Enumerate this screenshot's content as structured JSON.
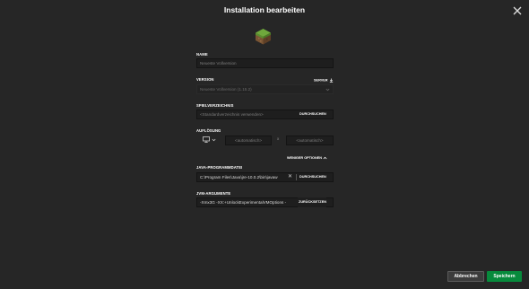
{
  "dialog": {
    "title": "Installation bearbeiten",
    "close_icon": "close-icon",
    "block_icon": "grass-block-icon"
  },
  "name": {
    "label": "NAME",
    "placeholder": "Neueste Vollversion"
  },
  "version": {
    "label": "VERSION",
    "server_link": "SERVER",
    "server_icon": "download-icon",
    "value": "Neueste Vollversion (1.15.2)",
    "chevron_icon": "chevron-down-icon"
  },
  "game_dir": {
    "label": "SPIELVERZEICHNIS",
    "placeholder": "<Standardverzeichnis verwenden>",
    "browse_label": "DURCHSUCHEN"
  },
  "resolution": {
    "label": "AUFLÖSUNG",
    "monitor_icon": "monitor-icon",
    "chevron_icon": "chevron-down-icon",
    "width_placeholder": "<automatisch>",
    "separator": "x",
    "height_placeholder": "<automatisch>"
  },
  "less_options": {
    "label": "WENIGER OPTIONEN",
    "icon": "chevron-up-icon"
  },
  "java_exec": {
    "label": "JAVA-PROGRAMMDATEI",
    "value": "C:\\Program Files\\Java\\jre-10.0.2\\bin\\javaw",
    "clear_icon": "clear-icon",
    "browse_label": "DURCHSUCHEN"
  },
  "jvm_args": {
    "label": "JVM-ARGUMENTE",
    "value": "-Xmx3G -XX:+UnlockExperimentalVMOptions -",
    "reset_label": "ZURÜCKSETZEN"
  },
  "footer": {
    "cancel_label": "Abbrechen",
    "save_label": "Speichern"
  },
  "colors": {
    "background": "#262626",
    "field": "#1e1e1e",
    "save_button": "#078a3c",
    "cancel_button": "#3c3c3c"
  }
}
